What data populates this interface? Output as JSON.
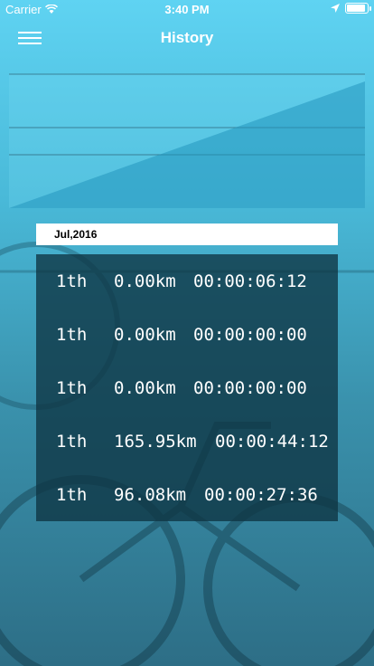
{
  "status_bar": {
    "carrier": "Carrier",
    "time": "3:40 PM",
    "battery_level": 1.0
  },
  "nav": {
    "title": "History",
    "menu_icon": "hamburger-menu-icon"
  },
  "month_label": "Jul,2016",
  "records": [
    {
      "day": "1th",
      "distance": "0.00km",
      "duration": "00:00:06:12"
    },
    {
      "day": "1th",
      "distance": "0.00km",
      "duration": "00:00:00:00"
    },
    {
      "day": "1th",
      "distance": "0.00km",
      "duration": "00:00:00:00"
    },
    {
      "day": "1th",
      "distance": "165.95km",
      "duration": "00:00:44:12"
    },
    {
      "day": "1th",
      "distance": "96.08km",
      "duration": "00:00:27:36"
    }
  ],
  "chart_data": {
    "type": "area",
    "x": [
      0,
      1
    ],
    "y": [
      0,
      1
    ],
    "gridlines": 3,
    "title": "",
    "xlabel": "",
    "ylabel": ""
  }
}
